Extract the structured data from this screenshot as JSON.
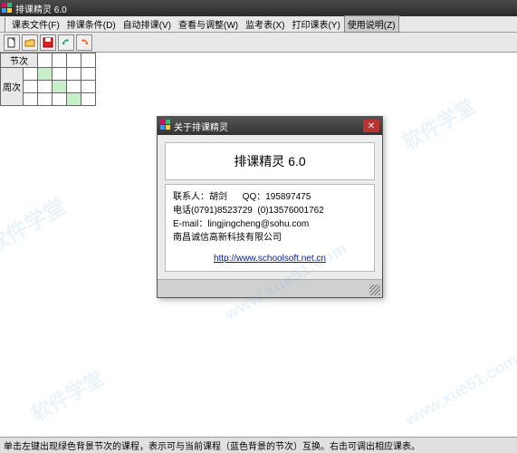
{
  "window": {
    "title": "排课精灵 6.0"
  },
  "menu": {
    "items": [
      {
        "label": "课表文件(F)"
      },
      {
        "label": "排课条件(D)"
      },
      {
        "label": "自动排课(V)"
      },
      {
        "label": "查看与调整(W)"
      },
      {
        "label": "监考表(X)"
      },
      {
        "label": "打印课表(Y)"
      },
      {
        "label": "使用说明(Z)"
      }
    ]
  },
  "grid": {
    "header": "节次",
    "rowlabel": "周次"
  },
  "dialog": {
    "title": "关于排课精灵",
    "product": "排课精灵 6.0",
    "contact_label": "联系人：",
    "contact_name": "胡剑",
    "qq_label": "QQ：",
    "qq": "195897475",
    "tel_label": "电话",
    "tel1": "(0791)8523729",
    "tel2": "(0)13576001762",
    "email_label": "E-mail：",
    "email": "lingjingcheng@sohu.com",
    "company": "南昌诚信高新科技有限公司",
    "url": "http://www.schoolsoft.net.cn"
  },
  "statusbar": {
    "text": "单击左键出现绿色背景节次的课程，表示可与当前课程（蓝色背景的节次）互换。右击可调出相应课表。"
  },
  "watermark": {
    "brand": "软件学堂",
    "site": "www.xue51.com"
  }
}
